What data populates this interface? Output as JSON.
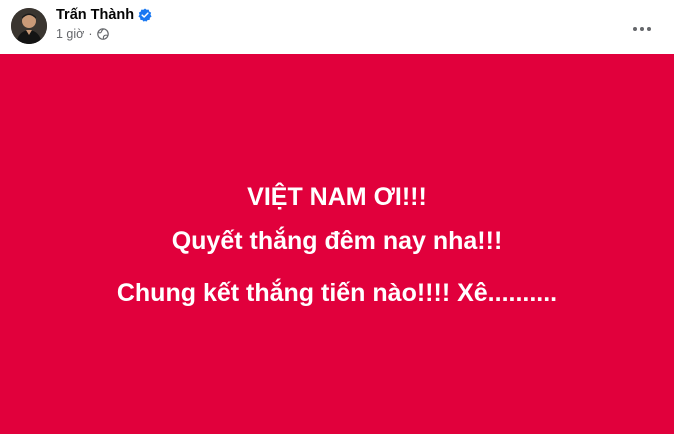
{
  "post": {
    "author": {
      "name": "Trấn Thành",
      "avatar_icon": "avatar-photo",
      "verified_icon": "verified-badge-icon",
      "verified_color": "#1877f2"
    },
    "meta": {
      "time": "1 giờ",
      "separator": "·",
      "privacy_icon": "globe-icon"
    },
    "menu_icon": "more-horizontal-icon",
    "background_color": "#e1003c",
    "text_color": "#ffffff",
    "status_lines": [
      "VIỆT NAM ƠI!!!",
      "Quyết thắng đêm nay nha!!!",
      "Chung kết thắng tiến nào!!!! Xê.........."
    ]
  }
}
